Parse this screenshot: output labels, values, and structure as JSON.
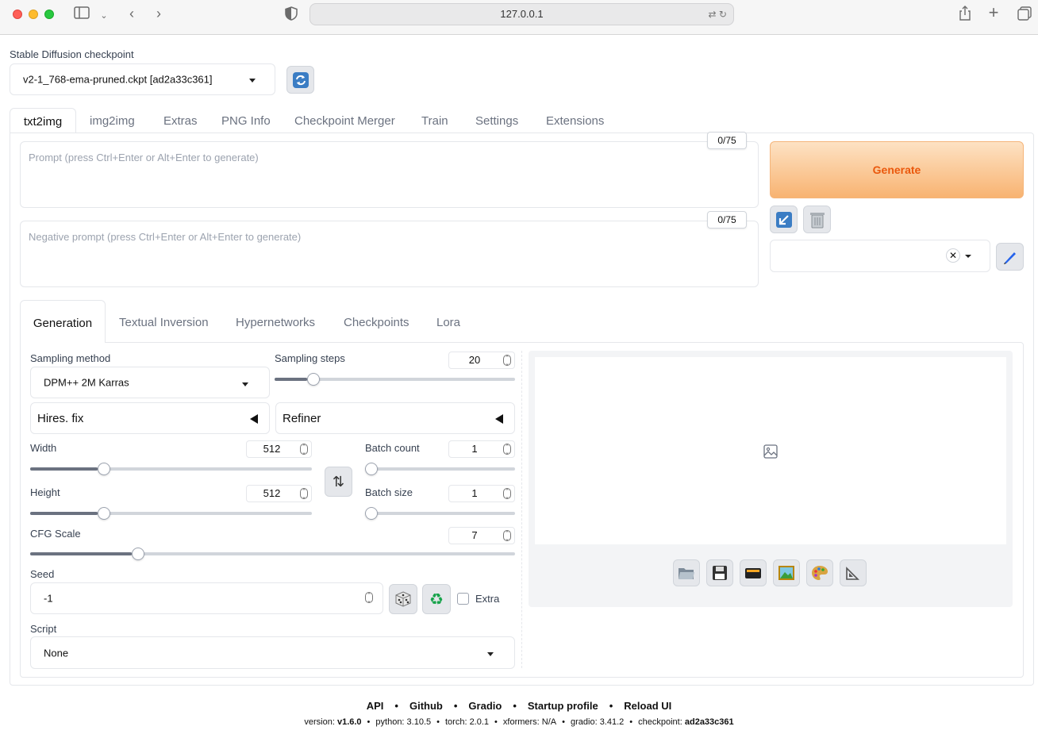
{
  "browser": {
    "url": "127.0.0.1"
  },
  "checkpoint": {
    "label": "Stable Diffusion checkpoint",
    "value": "v2-1_768-ema-pruned.ckpt [ad2a33c361]"
  },
  "main_tabs": [
    "txt2img",
    "img2img",
    "Extras",
    "PNG Info",
    "Checkpoint Merger",
    "Train",
    "Settings",
    "Extensions"
  ],
  "prompt": {
    "placeholder": "Prompt (press Ctrl+Enter or Alt+Enter to generate)",
    "counter": "0/75"
  },
  "negative_prompt": {
    "placeholder": "Negative prompt (press Ctrl+Enter or Alt+Enter to generate)",
    "counter": "0/75"
  },
  "generate_label": "Generate",
  "sub_tabs": [
    "Generation",
    "Textual Inversion",
    "Hypernetworks",
    "Checkpoints",
    "Lora"
  ],
  "sampling_method": {
    "label": "Sampling method",
    "value": "DPM++ 2M Karras"
  },
  "sampling_steps": {
    "label": "Sampling steps",
    "value": "20",
    "level": 0.135
  },
  "hires_fix": "Hires. fix",
  "refiner": "Refiner",
  "width": {
    "label": "Width",
    "value": "512",
    "level": 0.24
  },
  "height": {
    "label": "Height",
    "value": "512",
    "level": 0.24
  },
  "batch_count": {
    "label": "Batch count",
    "value": "1",
    "level": 0.0
  },
  "batch_size": {
    "label": "Batch size",
    "value": "1",
    "level": 0.0
  },
  "cfg_scale": {
    "label": "CFG Scale",
    "value": "7",
    "level": 0.21
  },
  "seed": {
    "label": "Seed",
    "value": "-1",
    "extra_label": "Extra"
  },
  "script": {
    "label": "Script",
    "value": "None"
  },
  "footer": {
    "links": [
      "API",
      "Github",
      "Gradio",
      "Startup profile",
      "Reload UI"
    ],
    "version_label": "version:",
    "version": "v1.6.0",
    "python": "python: 3.10.5",
    "torch": "torch: 2.0.1",
    "xformers": "xformers: N/A",
    "gradio": "gradio: 3.41.2",
    "checkpoint_label": "checkpoint:",
    "checkpoint": "ad2a33c361"
  }
}
